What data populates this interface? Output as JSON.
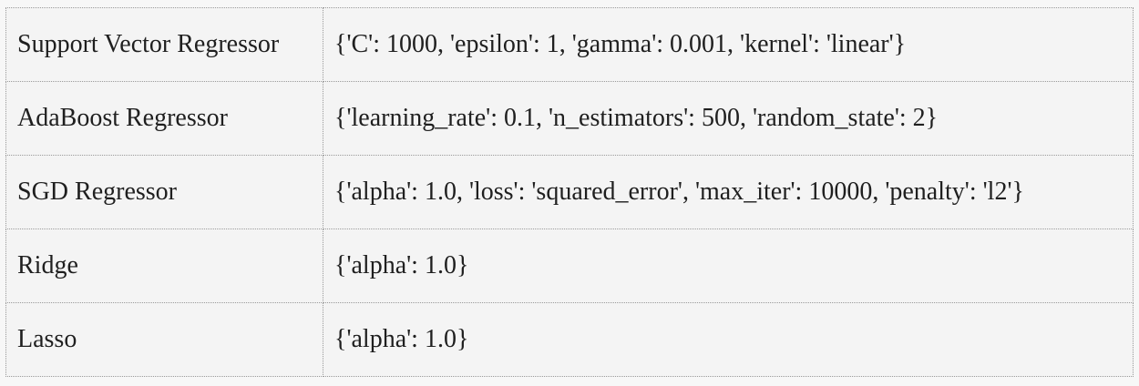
{
  "table": {
    "rows": [
      {
        "model": "Support Vector Regressor",
        "params": "{'C': 1000, 'epsilon': 1, 'gamma': 0.001, 'kernel': 'linear'}"
      },
      {
        "model": "AdaBoost Regressor",
        "params": "{'learning_rate': 0.1, 'n_estimators': 500, 'random_state': 2}"
      },
      {
        "model": "SGD Regressor",
        "params": "{'alpha': 1.0, 'loss': 'squared_error', 'max_iter': 10000, 'penalty': 'l2'}"
      },
      {
        "model": "Ridge",
        "params": "{'alpha': 1.0}"
      },
      {
        "model": "Lasso",
        "params": "{'alpha': 1.0}"
      }
    ]
  }
}
